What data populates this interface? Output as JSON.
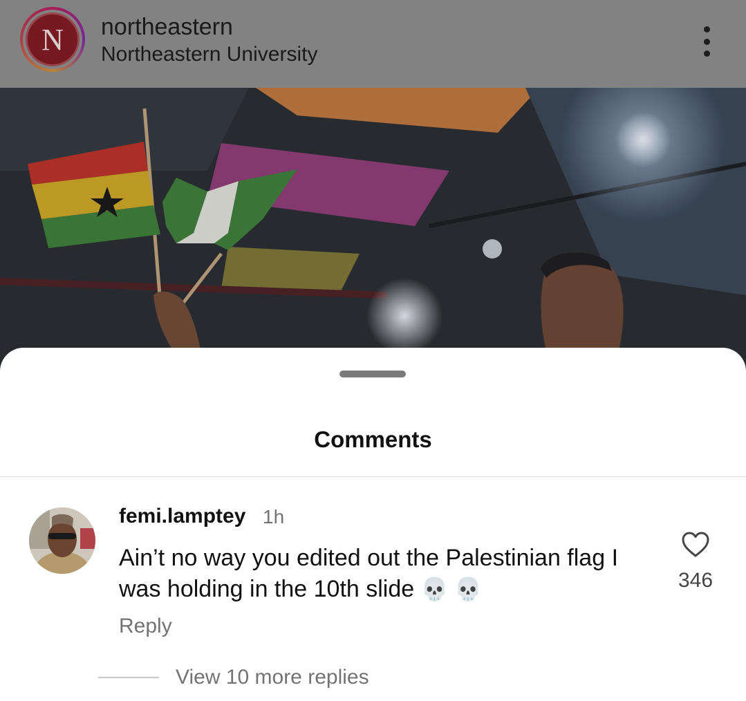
{
  "post": {
    "username": "northeastern",
    "subtitle": "Northeastern University",
    "avatar_letter": "N",
    "icons": {
      "more": "more-vertical-icon"
    }
  },
  "sheet": {
    "title": "Comments"
  },
  "comments": [
    {
      "username": "femi.lamptey",
      "time": "1h",
      "text": "Ain’t no way you edited out the Palestinian flag I was holding in the 10th slide",
      "emojis": "💀 💀",
      "likes": "346",
      "reply_label": "Reply",
      "view_replies_label": "View 10 more replies"
    }
  ],
  "colors": {
    "header_dim": "#8a8a8a",
    "brand_red": "#7e1b22",
    "text_primary": "#111111",
    "text_secondary": "#737373"
  }
}
